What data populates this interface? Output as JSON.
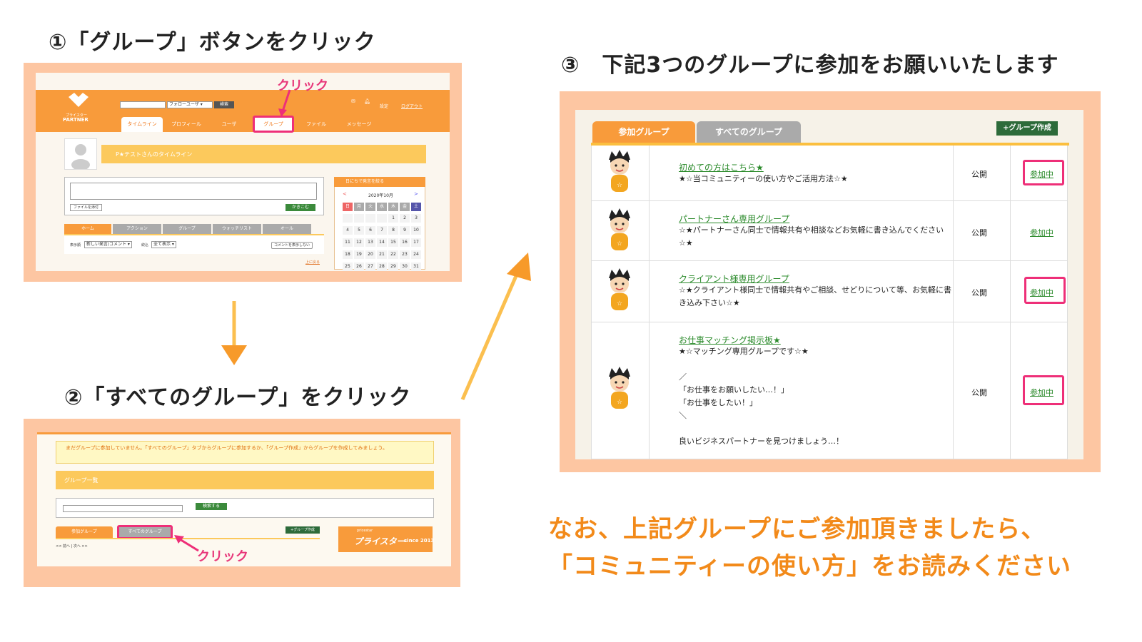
{
  "steps": {
    "step1": "①「グループ」ボタンをクリック",
    "step2": "②「すべてのグループ」をクリック",
    "step3": "③　下記3つのグループに参加をお願いいたします",
    "click": "クリック"
  },
  "shot1": {
    "logo_top": "プライスター",
    "logo_main": "PARTNER",
    "follow_select": "フォローユーザ ▾",
    "search_btn": "検索",
    "settings": "設定",
    "logout": "ログアウト",
    "nav": [
      "タイムライン",
      "プロフィール",
      "ユーザ",
      "グループ",
      "ファイル",
      "メッセージ"
    ],
    "timeline_title": "P★テストさんのタイムライン",
    "attach_btn": "ファイルを添付",
    "post_btn": "かきこむ",
    "feed_tabs": [
      "ホーム",
      "アクション",
      "グループ",
      "ウォッチリスト",
      "オール"
    ],
    "sort_label": "表示順",
    "sort_value": "新しい発言/コメント ▾",
    "filter_label": "絞込",
    "filter_value": "全て表示 ▾",
    "comment_toggle": "コメントを表示しない",
    "back_top": "上に戻る",
    "cal_title": "日にちで発言を絞る",
    "cal_prev": "<",
    "cal_month": "2020年10月",
    "cal_next": ">",
    "cal_days": [
      "日",
      "月",
      "火",
      "水",
      "木",
      "金",
      "土"
    ],
    "cal_rows": [
      [
        "",
        "",
        "",
        "",
        "1",
        "2",
        "3"
      ],
      [
        "4",
        "5",
        "6",
        "7",
        "8",
        "9",
        "10"
      ],
      [
        "11",
        "12",
        "13",
        "14",
        "15",
        "16",
        "17"
      ],
      [
        "18",
        "19",
        "20",
        "21",
        "22",
        "23",
        "24"
      ],
      [
        "25",
        "26",
        "27",
        "28",
        "29",
        "30",
        "31"
      ]
    ]
  },
  "shot2": {
    "notice": "まだグループに参加していません。「すべてのグループ」タブからグループに参加するか、「グループ作成」からグループを作成してみましょう。",
    "list_title": "グループ一覧",
    "search_btn": "検索する",
    "tab_joined": "参加グループ",
    "tab_all": "すべてのグループ",
    "create_btn": "+グループ作成",
    "pager": "<< 前へ | 次へ >>",
    "banner_small": "pricestar",
    "banner_main": "プライスター",
    "banner_since": "since 2013"
  },
  "shot3": {
    "tab_joined": "参加グループ",
    "tab_all": "すべてのグループ",
    "create_btn": "+グループ作成",
    "groups": [
      {
        "name": "初めての方はこちら★",
        "desc": "★☆当コミュニティーの使い方やご活用方法☆★",
        "visibility": "公開",
        "status": "参加中"
      },
      {
        "name": "パートナーさん専用グループ",
        "desc": "☆★パートナーさん同士で情報共有や相談などお気軽に書き込んでください☆★",
        "visibility": "公開",
        "status": "参加中"
      },
      {
        "name": "クライアント様専用グループ",
        "desc": "☆★クライアント様同士で情報共有やご相談、せどりについて等、お気軽に書き込み下さい☆★",
        "visibility": "公開",
        "status": "参加中"
      },
      {
        "name": "お仕事マッチング掲示板★",
        "desc": "★☆マッチング専用グループです☆★\n\n／\n「お仕事をお願いしたい…！」\n「お仕事をしたい！」\n＼\n\n良いビジネスパートナーを見つけましょう…！",
        "visibility": "公開",
        "status": "参加中"
      }
    ]
  },
  "note": {
    "line1": "なお、上記グループにご参加頂きましたら、",
    "line2": "「コミュニティーの使い方」をお読みください"
  },
  "colors": {
    "orange": "#f89b3b",
    "frame": "#fdc6a2",
    "pink": "#ee2f78",
    "green": "#3b8a3b",
    "note": "#f28a1a"
  }
}
